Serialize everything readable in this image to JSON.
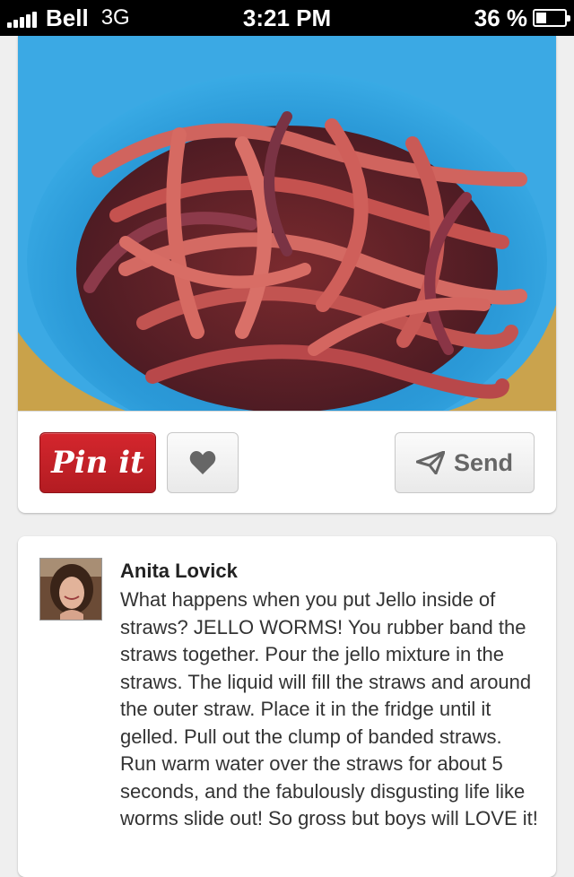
{
  "status_bar": {
    "carrier": "Bell",
    "network": "3G",
    "time": "3:21 PM",
    "battery_percent_label": "36 %",
    "battery_level": 0.36
  },
  "pin": {
    "image_icon": "jello-worms-photo",
    "pinit_label": "Pin it",
    "like_icon": "heart-icon",
    "send_label": "Send",
    "send_icon": "paper-plane-icon",
    "brand_color": "#cb2027"
  },
  "comment": {
    "author": "Anita Lovick",
    "avatar_icon": "user-avatar",
    "text": "What happens when you put Jello inside of straws? JELLO WORMS! You rubber band the straws together. Pour the jello mixture in the straws. The liquid will fill the straws and around the outer straw. Place it in the fridge until it gelled. Pull out the clump of banded straws. Run warm water over the straws for about 5 seconds, and the fabulously disgusting life like worms slide out! So gross but boys will LOVE it!"
  }
}
